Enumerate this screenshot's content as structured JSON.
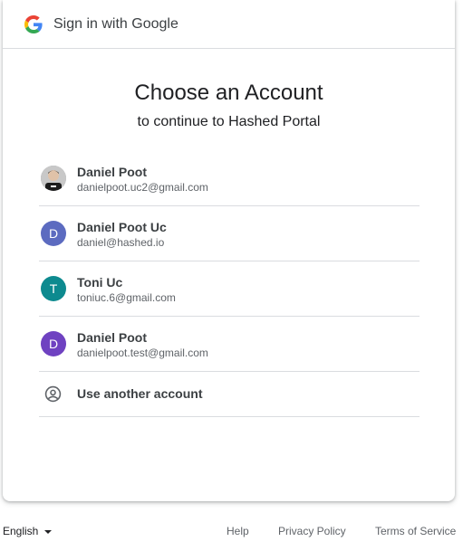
{
  "header": {
    "title": "Sign in with Google"
  },
  "main": {
    "title": "Choose an Account",
    "subtitle": "to continue to Hashed Portal"
  },
  "accounts": [
    {
      "name": "Daniel Poot",
      "email": "danielpoot.uc2@gmail.com",
      "avatar_letter": "",
      "avatar_color": "#9aa0a6"
    },
    {
      "name": "Daniel Poot Uc",
      "email": "daniel@hashed.io",
      "avatar_letter": "D",
      "avatar_color": "#5c6bc0"
    },
    {
      "name": "Toni Uc",
      "email": "toniuc.6@gmail.com",
      "avatar_letter": "T",
      "avatar_color": "#0d8a8f"
    },
    {
      "name": "Daniel Poot",
      "email": "danielpoot.test@gmail.com",
      "avatar_letter": "D",
      "avatar_color": "#6f42c1"
    }
  ],
  "use_another": {
    "label": "Use another account",
    "icon": "account-circle-icon"
  },
  "footer": {
    "language": "English",
    "help": "Help",
    "privacy": "Privacy Policy",
    "terms": "Terms of Service"
  }
}
